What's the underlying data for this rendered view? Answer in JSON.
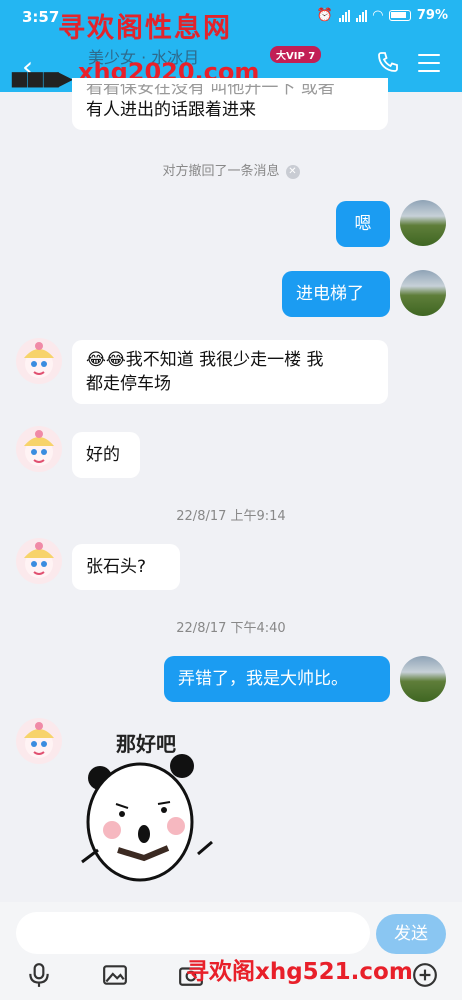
{
  "status": {
    "time": "3:57",
    "battery": "79%"
  },
  "watermarks": {
    "top": "寻欢阁性息网",
    "url": "xhg2020.com",
    "bottom": "寻欢阁xhg521.com"
  },
  "header": {
    "contact_name": "美少女 · 水冰月",
    "vip_badge": "大VIP 7"
  },
  "messages": {
    "m1_partial": "看看保安在没有 叫他开一下 或者",
    "m1_line2": "有人进出的话跟着进来",
    "recall_notice": "对方撤回了一条消息",
    "m2": "嗯",
    "m3": "进电梯了",
    "m4_line1": "😂😂我不知道 我很少走一楼 我",
    "m4_line2": "都走停车场",
    "m5": "好的",
    "ts1": "22/8/17 上午9:14",
    "m6": "张石头?",
    "ts2": "22/8/17 下午4:40",
    "m7": "弄错了，我是大帅比。",
    "sticker_text": "那好吧"
  },
  "input": {
    "placeholder": "",
    "send_label": "发送"
  },
  "colors": {
    "header": "#24b6f2",
    "my_bubble": "#1b9cf2",
    "send_button": "#8ac6f2"
  },
  "icons": [
    "back-icon",
    "phone-icon",
    "menu-icon",
    "mic-icon",
    "image-icon",
    "camera-icon",
    "plus-icon"
  ]
}
